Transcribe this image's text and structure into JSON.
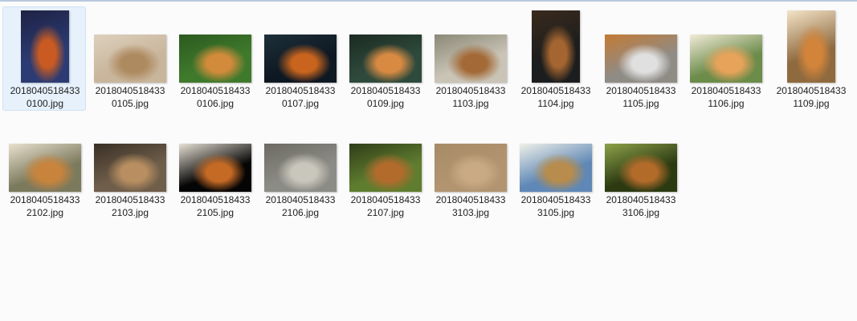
{
  "files": [
    {
      "name_line1": "2018040518433",
      "name_line2": "0100.jpg",
      "selected": true,
      "thumb": {
        "orient": "portrait",
        "colors": [
          "#2c3b73",
          "#c95b22",
          "#1e2244"
        ]
      }
    },
    {
      "name_line1": "2018040518433",
      "name_line2": "0105.jpg",
      "selected": false,
      "thumb": {
        "orient": "landscape",
        "colors": [
          "#c8b59b",
          "#ae8a60",
          "#ddd0bd"
        ]
      }
    },
    {
      "name_line1": "2018040518433",
      "name_line2": "0106.jpg",
      "selected": false,
      "thumb": {
        "orient": "landscape",
        "colors": [
          "#3f7a2c",
          "#d18b3a",
          "#2c5a20"
        ]
      }
    },
    {
      "name_line1": "2018040518433",
      "name_line2": "0107.jpg",
      "selected": false,
      "thumb": {
        "orient": "landscape",
        "colors": [
          "#0e1822",
          "#c8641e",
          "#1d2f3a"
        ]
      }
    },
    {
      "name_line1": "2018040518433",
      "name_line2": "0109.jpg",
      "selected": false,
      "thumb": {
        "orient": "landscape",
        "colors": [
          "#2e4a3c",
          "#d88a43",
          "#1c2a22"
        ]
      }
    },
    {
      "name_line1": "2018040518433",
      "name_line2": "1103.jpg",
      "selected": false,
      "thumb": {
        "orient": "landscape",
        "colors": [
          "#c9c4b6",
          "#a36a38",
          "#8b8876"
        ]
      }
    },
    {
      "name_line1": "2018040518433",
      "name_line2": "1104.jpg",
      "selected": false,
      "thumb": {
        "orient": "portrait",
        "colors": [
          "#1b1d1e",
          "#a46530",
          "#3a2a1c"
        ]
      }
    },
    {
      "name_line1": "2018040518433",
      "name_line2": "1105.jpg",
      "selected": false,
      "thumb": {
        "orient": "landscape",
        "colors": [
          "#8f8c86",
          "#e0e0e0",
          "#c37a35"
        ]
      }
    },
    {
      "name_line1": "2018040518433",
      "name_line2": "1106.jpg",
      "selected": false,
      "thumb": {
        "orient": "landscape",
        "colors": [
          "#6c8c4a",
          "#e8a35a",
          "#f2ead8"
        ]
      }
    },
    {
      "name_line1": "2018040518433",
      "name_line2": "1109.jpg",
      "selected": false,
      "thumb": {
        "orient": "portrait",
        "colors": [
          "#8f6a3f",
          "#d2843b",
          "#f3e4c8"
        ]
      }
    },
    {
      "name_line1": "2018040518433",
      "name_line2": "2102.jpg",
      "selected": false,
      "thumb": {
        "orient": "landscape",
        "colors": [
          "#7c7a5d",
          "#c8843c",
          "#e9e1cf"
        ]
      }
    },
    {
      "name_line1": "2018040518433",
      "name_line2": "2103.jpg",
      "selected": false,
      "thumb": {
        "orient": "landscape",
        "colors": [
          "#6f5e4a",
          "#b98f61",
          "#3a3026"
        ]
      }
    },
    {
      "name_line1": "2018040518433",
      "name_line2": "2105.jpg",
      "selected": false,
      "thumb": {
        "orient": "landscape",
        "colors": [
          "#050505",
          "#c56a25",
          "#e7e1d5"
        ]
      }
    },
    {
      "name_line1": "2018040518433",
      "name_line2": "2106.jpg",
      "selected": false,
      "thumb": {
        "orient": "landscape",
        "colors": [
          "#8c8c86",
          "#c9c6bb",
          "#6c6a62"
        ]
      }
    },
    {
      "name_line1": "2018040518433",
      "name_line2": "2107.jpg",
      "selected": false,
      "thumb": {
        "orient": "landscape",
        "colors": [
          "#5f7d2f",
          "#b36b2c",
          "#2f3d18"
        ]
      }
    },
    {
      "name_line1": "2018040518433",
      "name_line2": "3103.jpg",
      "selected": false,
      "thumb": {
        "orient": "landscape",
        "colors": [
          "#b29470",
          "#c9aa84",
          "#a78b67"
        ]
      }
    },
    {
      "name_line1": "2018040518433",
      "name_line2": "3105.jpg",
      "selected": false,
      "thumb": {
        "orient": "landscape",
        "colors": [
          "#5f88b6",
          "#b78c4c",
          "#f0f0e8"
        ]
      }
    },
    {
      "name_line1": "2018040518433",
      "name_line2": "3106.jpg",
      "selected": false,
      "thumb": {
        "orient": "landscape",
        "colors": [
          "#2c3a12",
          "#b36b2a",
          "#8da24a"
        ]
      }
    }
  ]
}
